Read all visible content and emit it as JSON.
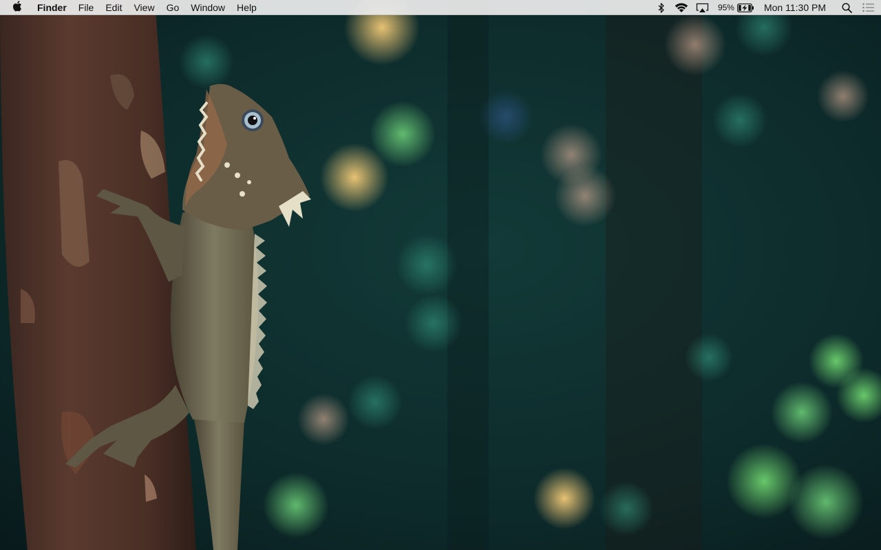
{
  "menubar": {
    "apple_icon": "apple-logo-icon",
    "app_name": "Finder",
    "menus": [
      "File",
      "Edit",
      "View",
      "Go",
      "Window",
      "Help"
    ],
    "status": {
      "bluetooth_icon": "bluetooth-icon",
      "wifi_icon": "wifi-icon",
      "airplay_icon": "airplay-icon",
      "battery_percent": "95%",
      "battery_icon": "battery-charging-icon",
      "clock": "Mon 11:30 PM",
      "spotlight_icon": "search-icon",
      "notification_icon": "notification-center-icon"
    }
  },
  "desktop": {
    "wallpaper": "lizard-on-tree-bokeh"
  }
}
